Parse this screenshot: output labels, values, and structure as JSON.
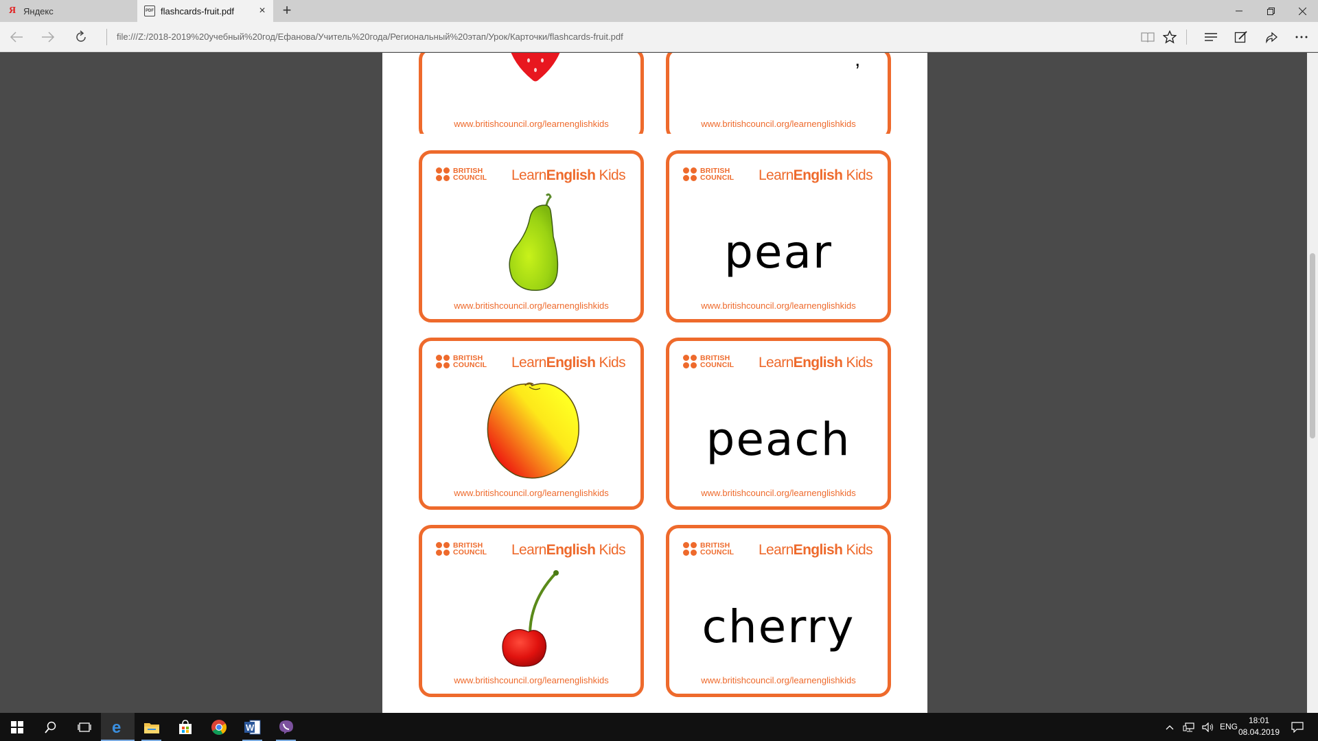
{
  "tabs": [
    {
      "title": "Яндекс",
      "favicon": "yandex-icon",
      "active": false
    },
    {
      "title": "flashcards-fruit.pdf",
      "favicon": "pdf-icon",
      "active": true
    }
  ],
  "address": {
    "url": "file:///Z:/2018-2019%20учебный%20год/Ефанова/Учитель%20года/Региональный%20этап/Урок/Карточки/flashcards-fruit.pdf"
  },
  "card_branding": {
    "bc_line1": "BRITISH",
    "bc_line2": "COUNCIL",
    "learn": "Learn",
    "english": "English",
    "kids": " Kids",
    "url": "www.britishcouncil.org/learnenglishkids"
  },
  "cards": [
    {
      "word": "pear",
      "image": "pear-icon"
    },
    {
      "word": "peach",
      "image": "peach-icon"
    },
    {
      "word": "cherry",
      "image": "cherry-icon"
    }
  ],
  "partial_cards": {
    "left_image": "strawberry-icon",
    "right_text_fragment": ","
  },
  "taskbar": {
    "apps": [
      "windows-start-icon",
      "search-icon",
      "task-view-icon",
      "edge-icon",
      "file-explorer-icon",
      "store-icon",
      "chrome-icon",
      "word-icon",
      "viber-icon"
    ],
    "language": "ENG",
    "time": "18:01",
    "date": "08.04.2019"
  },
  "colors": {
    "brand_orange": "#ee6a2c",
    "viewer_bg": "#4a4a4a",
    "taskbar_bg": "#111111"
  }
}
